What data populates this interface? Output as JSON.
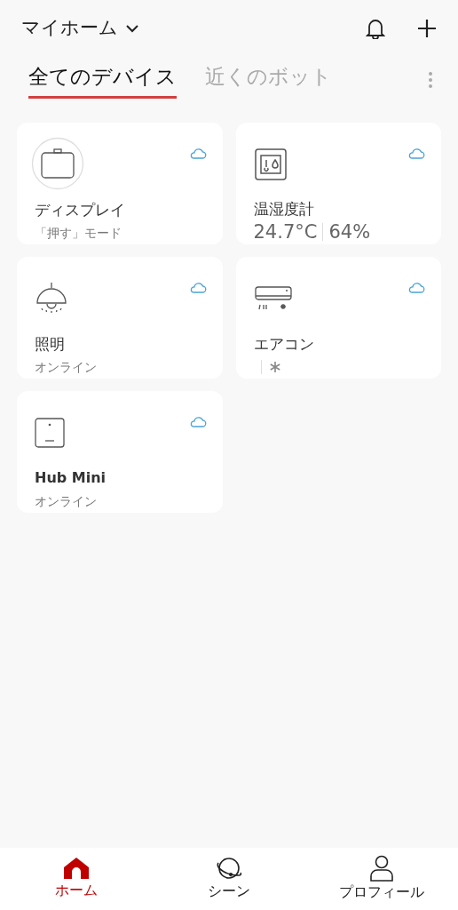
{
  "header": {
    "title": "マイホーム"
  },
  "tabs": [
    {
      "label": "全てのデバイス",
      "selected": true
    },
    {
      "label": "近くのボット",
      "selected": false
    }
  ],
  "devices": [
    {
      "kind": "bot",
      "name": "ディスプレイ",
      "status": {
        "kind": "text",
        "text": "「押す」モード"
      }
    },
    {
      "kind": "meter",
      "name": "温湿度計",
      "status": {
        "kind": "reading",
        "temperature": "24.7°C",
        "humidity": "64%"
      }
    },
    {
      "kind": "light",
      "name": "照明",
      "status": {
        "kind": "text",
        "text": "オンライン"
      }
    },
    {
      "kind": "aircon",
      "name": "エアコン",
      "status": {
        "kind": "mode",
        "cooling": true
      }
    },
    {
      "kind": "hub",
      "name": "Hub Mini",
      "status": {
        "kind": "text",
        "text": "オンライン"
      }
    }
  ],
  "nav": [
    {
      "kind": "home",
      "label": "ホーム",
      "selected": true
    },
    {
      "kind": "scene",
      "label": "シーン",
      "selected": false
    },
    {
      "kind": "profile",
      "label": "プロフィール",
      "selected": false
    }
  ]
}
